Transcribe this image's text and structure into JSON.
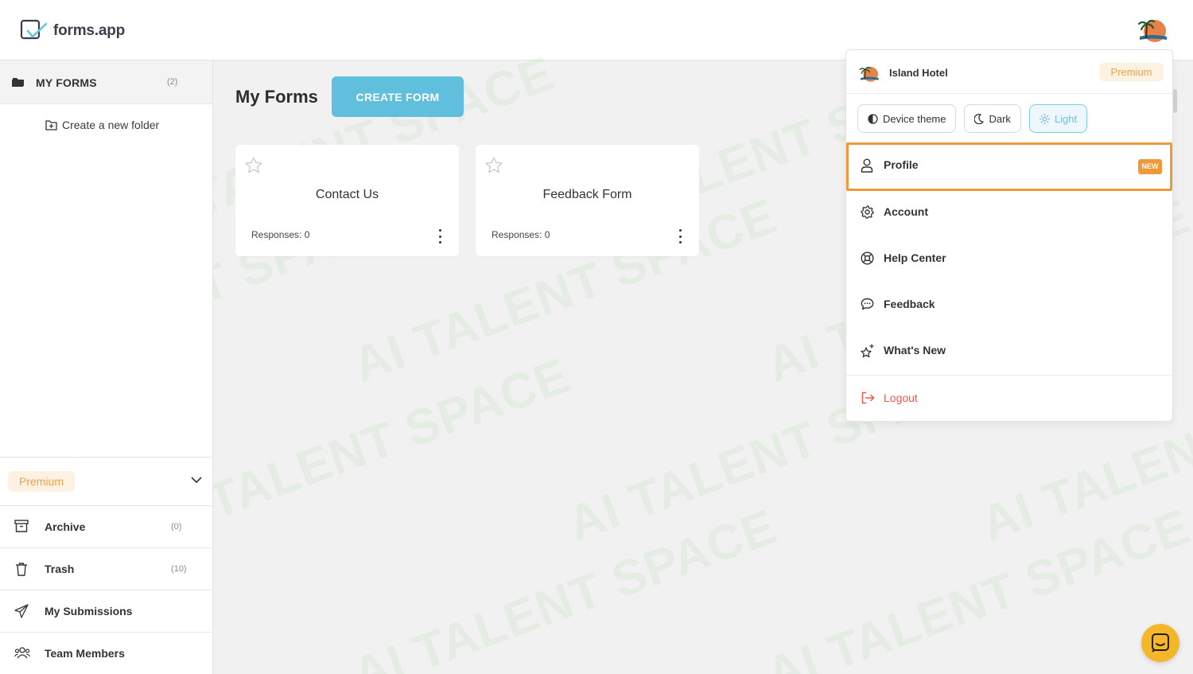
{
  "brand": {
    "logo_text": "forms.app"
  },
  "sidebar": {
    "my_forms_label": "MY FORMS",
    "my_forms_count": "(2)",
    "new_folder_label": "Create a new folder",
    "plan_label": "Premium",
    "items": [
      {
        "label": "Archive",
        "count": "(0)",
        "icon": "archive-icon"
      },
      {
        "label": "Trash",
        "count": "(10)",
        "icon": "trash-icon"
      },
      {
        "label": "My Submissions",
        "count": "",
        "icon": "paper-plane-icon"
      },
      {
        "label": "Team Members",
        "count": "",
        "icon": "team-icon"
      }
    ]
  },
  "main": {
    "title": "My Forms",
    "create_button": "CREATE FORM",
    "forms": [
      {
        "title": "Contact Us",
        "responses": "Responses: 0"
      },
      {
        "title": "Feedback Form",
        "responses": "Responses: 0"
      }
    ]
  },
  "dropdown": {
    "user_name": "Island Hotel",
    "plan": "Premium",
    "themes": [
      {
        "label": "Device theme",
        "active": false
      },
      {
        "label": "Dark",
        "active": false
      },
      {
        "label": "Light",
        "active": true
      }
    ],
    "menu": [
      {
        "label": "Profile",
        "badge": "NEW"
      },
      {
        "label": "Account"
      },
      {
        "label": "Help Center"
      },
      {
        "label": "Feedback"
      },
      {
        "label": "What's New"
      }
    ],
    "logout_label": "Logout"
  },
  "watermark": "AI TALENT SPACE",
  "colors": {
    "accent": "#5fbfdc",
    "premium": "#e9a24b",
    "highlight": "#f0993a",
    "logout": "#e85a4f",
    "chat": "#f5b72a"
  }
}
